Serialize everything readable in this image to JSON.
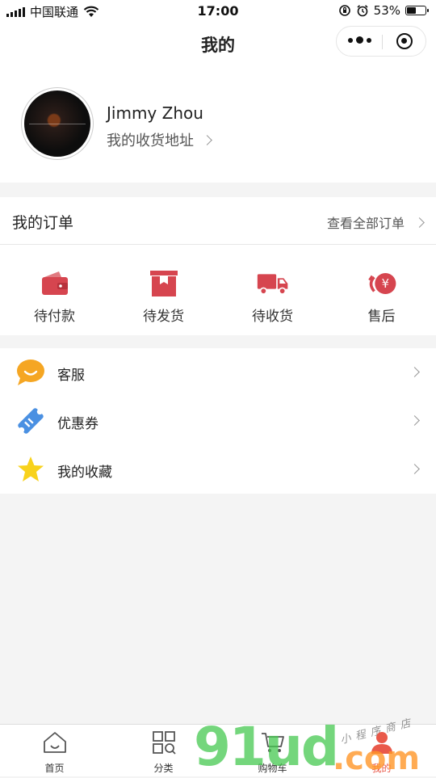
{
  "status_bar": {
    "carrier": "中国联通",
    "time": "17:00",
    "battery_percent": "53%",
    "battery_level": 0.53
  },
  "nav": {
    "title": "我的"
  },
  "profile": {
    "username": "Jimmy Zhou",
    "address_link": "我的收货地址"
  },
  "orders": {
    "title": "我的订单",
    "view_all": "查看全部订单",
    "statuses": [
      {
        "label": "待付款",
        "icon": "wallet-icon"
      },
      {
        "label": "待发货",
        "icon": "package-icon"
      },
      {
        "label": "待收货",
        "icon": "truck-icon"
      },
      {
        "label": "售后",
        "icon": "refund-icon"
      }
    ]
  },
  "menu": [
    {
      "label": "客服",
      "icon": "chat-bubble-icon"
    },
    {
      "label": "优惠券",
      "icon": "coupon-icon"
    },
    {
      "label": "我的收藏",
      "icon": "star-icon"
    }
  ],
  "tabs": [
    {
      "label": "首页",
      "icon": "home-icon"
    },
    {
      "label": "分类",
      "icon": "category-icon"
    },
    {
      "label": "购物车",
      "icon": "cart-icon"
    },
    {
      "label": "我的",
      "icon": "user-icon",
      "active": true
    }
  ],
  "watermark": {
    "big": "91ud",
    "com": ".com",
    "small": "小程序商店"
  },
  "colors": {
    "accent_red": "#d6454f",
    "active_tab": "#e9594a",
    "service_orange": "#f5a623",
    "coupon_blue": "#4a90e2",
    "star_yellow": "#f8d21c"
  }
}
